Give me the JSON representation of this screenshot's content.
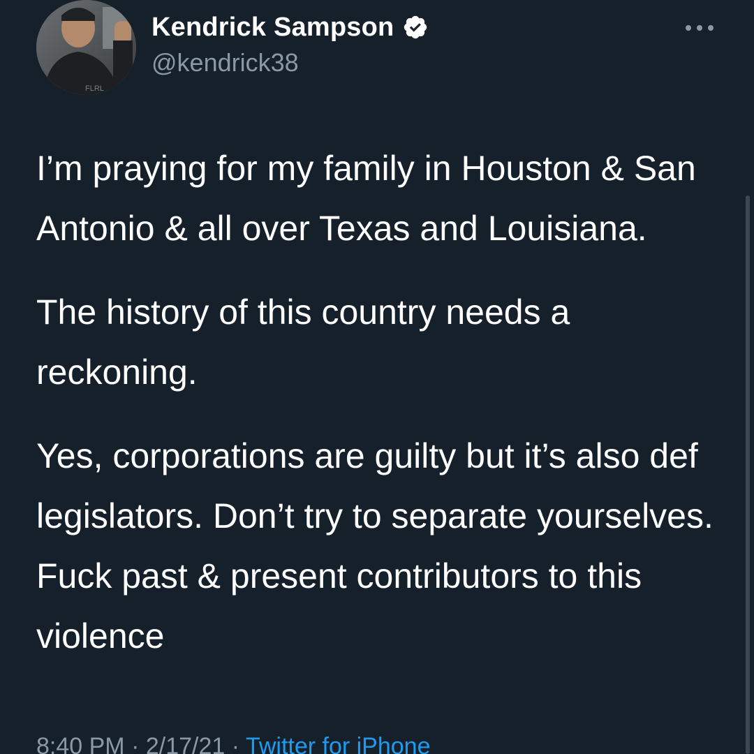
{
  "tweet": {
    "author": {
      "display_name": "Kendrick Sampson",
      "handle": "@kendrick38",
      "verified": true,
      "avatar_shirt_text": "FLRL"
    },
    "more_icon": "ellipsis-icon",
    "paragraphs": [
      "I’m praying for my family in Houston & San Antonio & all over Texas and Louisiana.",
      "The history of this country needs a reckoning.",
      "Yes, corporations are guilty but it’s also def legislators.  Don’t try to separate yourselves.  Fuck past & present contributors to this violence"
    ],
    "meta": {
      "time": "8:40 PM",
      "separator": "·",
      "date": "2/17/21",
      "source": "Twitter for iPhone"
    }
  },
  "colors": {
    "background": "#15202b",
    "text": "#ffffff",
    "secondary": "#8b98a5",
    "accent": "#1d9bf0",
    "verified_badge": "#ffffff"
  }
}
